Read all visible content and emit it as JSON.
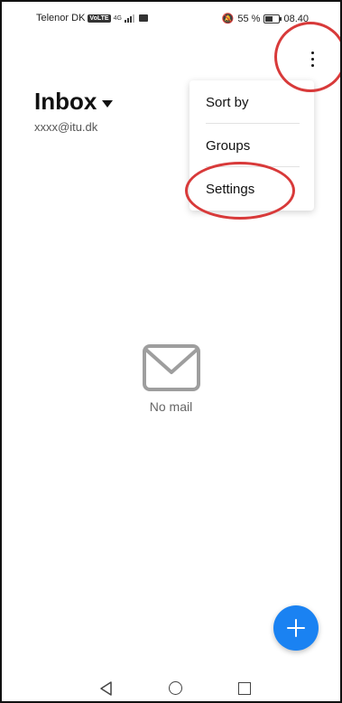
{
  "status_bar": {
    "carrier": "Telenor DK",
    "volte": "VoLTE",
    "network": "4G",
    "battery": "55 %",
    "time": "08.40",
    "icons": [
      "volte-icon",
      "signal-icon",
      "sim-icon",
      "mute-icon",
      "battery-icon"
    ]
  },
  "header": {
    "title": "Inbox",
    "account": "xxxx@itu.dk",
    "dropdown_icon": "caret-down-icon"
  },
  "overflow_menu": {
    "icon": "more-vert-icon",
    "items": [
      {
        "label": "Sort by"
      },
      {
        "label": "Groups"
      },
      {
        "label": "Settings"
      }
    ]
  },
  "empty_state": {
    "icon": "mail-icon",
    "text": "No mail"
  },
  "fab": {
    "icon": "plus-icon",
    "color": "#1a82f2"
  },
  "annotation_color": "#d83a3a",
  "nav_bar": {
    "icons": [
      "back-icon",
      "home-icon",
      "recent-apps-icon"
    ]
  }
}
